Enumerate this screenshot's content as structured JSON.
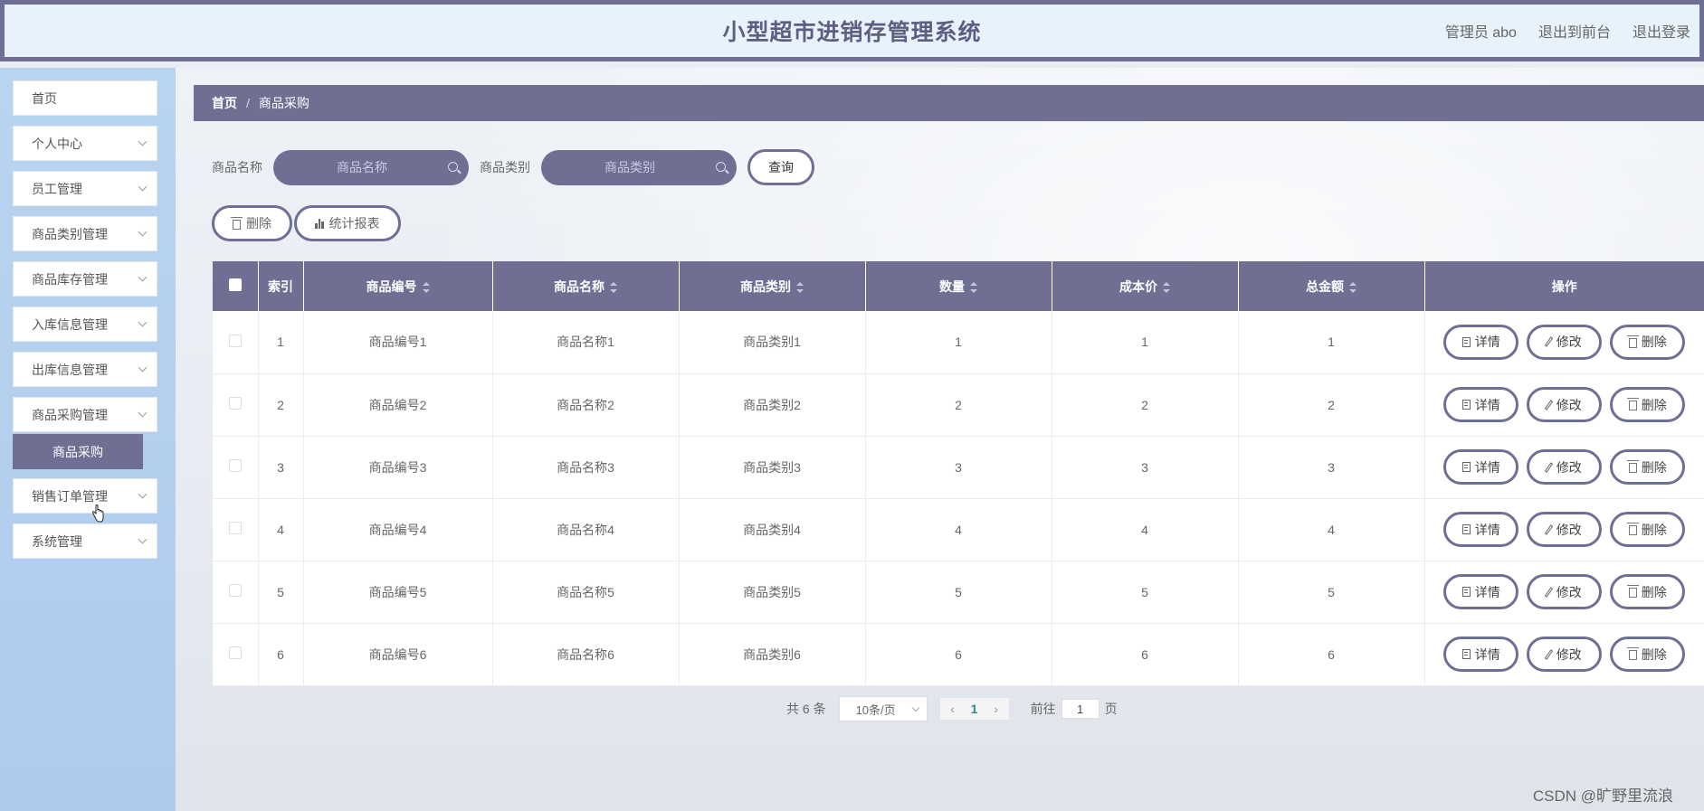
{
  "header": {
    "title": "小型超市进销存管理系统",
    "user": "管理员 abo",
    "to_front": "退出到前台",
    "logout": "退出登录"
  },
  "sidebar": {
    "items": [
      {
        "label": "首页"
      },
      {
        "label": "个人中心"
      },
      {
        "label": "员工管理"
      },
      {
        "label": "商品类别管理"
      },
      {
        "label": "商品库存管理"
      },
      {
        "label": "入库信息管理"
      },
      {
        "label": "出库信息管理"
      },
      {
        "label": "商品采购管理"
      },
      {
        "label": "销售订单管理"
      },
      {
        "label": "系统管理"
      }
    ],
    "submenu_active": "商品采购"
  },
  "breadcrumb": {
    "home": "首页",
    "separator": "/",
    "current": "商品采购"
  },
  "search": {
    "name_label": "商品名称",
    "name_placeholder": "商品名称",
    "category_label": "商品类别",
    "category_placeholder": "商品类别",
    "query_button": "查询"
  },
  "actions": {
    "delete": "删除",
    "report": "统计报表"
  },
  "table": {
    "columns": [
      "索引",
      "商品编号",
      "商品名称",
      "商品类别",
      "数量",
      "成本价",
      "总金额",
      "操作"
    ],
    "rows": [
      {
        "index": "1",
        "code": "商品编号1",
        "name": "商品名称1",
        "category": "商品类别1",
        "qty": "1",
        "cost": "1",
        "total": "1"
      },
      {
        "index": "2",
        "code": "商品编号2",
        "name": "商品名称2",
        "category": "商品类别2",
        "qty": "2",
        "cost": "2",
        "total": "2"
      },
      {
        "index": "3",
        "code": "商品编号3",
        "name": "商品名称3",
        "category": "商品类别3",
        "qty": "3",
        "cost": "3",
        "total": "3"
      },
      {
        "index": "4",
        "code": "商品编号4",
        "name": "商品名称4",
        "category": "商品类别4",
        "qty": "4",
        "cost": "4",
        "total": "4"
      },
      {
        "index": "5",
        "code": "商品编号5",
        "name": "商品名称5",
        "category": "商品类别5",
        "qty": "5",
        "cost": "5",
        "total": "5"
      },
      {
        "index": "6",
        "code": "商品编号6",
        "name": "商品名称6",
        "category": "商品类别6",
        "qty": "6",
        "cost": "6",
        "total": "6"
      }
    ],
    "row_actions": {
      "detail": "详情",
      "edit": "修改",
      "delete": "删除"
    }
  },
  "pagination": {
    "total": "共 6 条",
    "page_size": "10条/页",
    "current_page": "1",
    "goto_label": "前往",
    "goto_value": "1",
    "goto_suffix": "页"
  },
  "watermark": "CSDN @旷野里流浪",
  "colors": {
    "accent": "#6e6f93",
    "header_bg": "#e7f2fb",
    "sidebar_bg": "#b3cfee"
  }
}
